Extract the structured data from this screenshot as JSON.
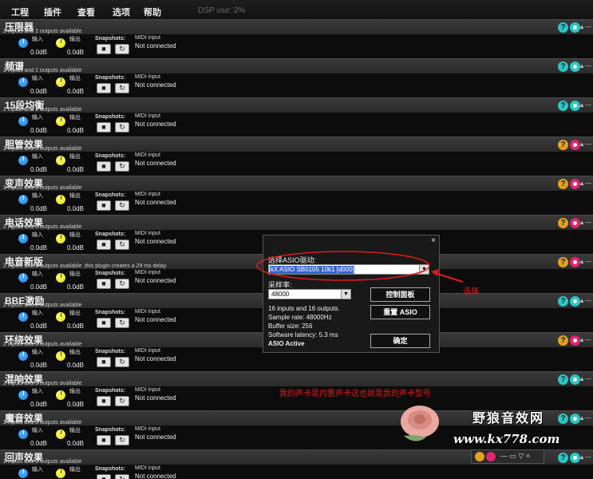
{
  "menu": [
    "工程",
    "插件",
    "查看",
    "选项",
    "帮助"
  ],
  "dsp_usage": "DSP use: 2%",
  "strings": {
    "input": "输入",
    "output": "输出",
    "db": "0.0dB",
    "snapshots": "Snapshots:",
    "midi_label": "MIDI input",
    "midi_value": "Not connected",
    "icon_a_glyph": "?",
    "mini_controls": "▲—"
  },
  "plugins": [
    {
      "title": "压限器",
      "subtitle": "2 inputs and 2 outputs available",
      "icon_color": "teal"
    },
    {
      "title": "频谱",
      "subtitle": "2 inputs and 2 outputs available",
      "icon_color": "teal"
    },
    {
      "title": "15段均衡",
      "subtitle": "2 inputs and 2 outputs available",
      "icon_color": "teal"
    },
    {
      "title": "胆管效果",
      "subtitle": "2 inputs and 2 outputs available",
      "icon_color": "warm"
    },
    {
      "title": "变声效果",
      "subtitle": "2 inputs and 2 outputs available",
      "icon_color": "warm"
    },
    {
      "title": "电话效果",
      "subtitle": "2 inputs and 2 outputs available",
      "icon_color": "warm"
    },
    {
      "title": "电音新版",
      "subtitle": "2 inputs and 2 outputs available ,this plugin creates a 29 ms delay",
      "icon_color": "warm"
    },
    {
      "title": "BBE激励",
      "subtitle": "2 inputs and 2 outputs available",
      "icon_color": "teal"
    },
    {
      "title": "环绕效果",
      "subtitle": "2 inputs and 2 outputs available",
      "icon_color": "warm"
    },
    {
      "title": "混响效果",
      "subtitle": "2 inputs and 2 outputs available",
      "icon_color": "teal"
    },
    {
      "title": "魔音效果",
      "subtitle": "2 inputs and 2 outputs available",
      "icon_color": "teal"
    },
    {
      "title": "回声效果",
      "subtitle": "2 inputs and 2 outputs available",
      "icon_color": "teal"
    }
  ],
  "dialog": {
    "close": "×",
    "asio_label": "选择ASIO驱动:",
    "asio_value": "kX ASIO SB0105 10k1 [d000]",
    "rate_label": "采样率:",
    "rate_value": "48000",
    "info": [
      "16 inputs and 16 outputs.",
      "Sample rate: 48000Hz",
      "Buffer size: 256",
      "Software latency: 5.3 ms"
    ],
    "active": "ASIO Active",
    "btn_panel": "控制面板",
    "btn_reset": "重置 ASIO",
    "btn_ok": "确定"
  },
  "annotations": {
    "select": "选择",
    "note": "我的声卡是内置声卡这也就是我的声卡型号"
  },
  "watermark": {
    "line1": "野狼音效网",
    "line2": "www.kx778.com"
  },
  "floating_bar": {
    "controls": "— ▭ ▽ ×"
  },
  "colors": {
    "teal": "#2bc6c6",
    "orange": "#e3a020",
    "pink": "#e12470",
    "annotation_red": "#e01b1b",
    "selection_blue": "#3366cc"
  }
}
